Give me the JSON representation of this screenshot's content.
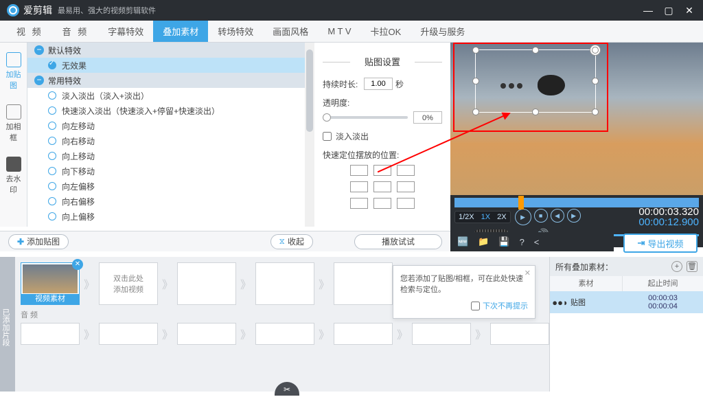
{
  "titlebar": {
    "app": "爱剪辑",
    "sub": "最易用、强大的视频剪辑软件"
  },
  "tabs": [
    "视 频",
    "音 频",
    "字幕特效",
    "叠加素材",
    "转场特效",
    "画面风格",
    "M T V",
    "卡拉OK",
    "升级与服务"
  ],
  "sidebar": [
    {
      "label": "加贴图"
    },
    {
      "label": "加相框"
    },
    {
      "label": "去水印"
    }
  ],
  "effects": {
    "group1": "默认特效",
    "selected": "无效果",
    "group2": "常用特效",
    "items": [
      "淡入淡出（淡入+淡出）",
      "快速淡入淡出（快速淡入+停留+快速淡出）",
      "向左移动",
      "向右移动",
      "向上移动",
      "向下移动",
      "向左偏移",
      "向右偏移",
      "向上偏移"
    ]
  },
  "settings": {
    "title": "贴图设置",
    "duration_label": "持续时长:",
    "duration_value": "1.00",
    "duration_unit": "秒",
    "opacity_label": "透明度:",
    "opacity_value": "0%",
    "fade_label": "淡入淡出",
    "pos_label": "快速定位摆放的位置:"
  },
  "toolbar": {
    "add": "添加贴图",
    "collapse": "收起",
    "test": "播放试试"
  },
  "speed": [
    "1/2X",
    "1X",
    "2X"
  ],
  "time": {
    "current": "00:00:03.320",
    "total": "00:00:12.900"
  },
  "export": "导出视频",
  "bottom": {
    "leftlabel": "已添加片段",
    "clip1": "视频素材",
    "placeholder": "双击此处\n添加视频",
    "audio": "音 频"
  },
  "tooltip": {
    "text": "您若添加了贴图/相框，可在此处快速检索与定位。",
    "dont_show": "下次不再提示"
  },
  "rightpanel": {
    "title": "所有叠加素材：",
    "col1": "素材",
    "col2": "起止时间",
    "item_name": "贴图",
    "item_t1": "00:00:03",
    "item_t2": "00:00:04"
  }
}
